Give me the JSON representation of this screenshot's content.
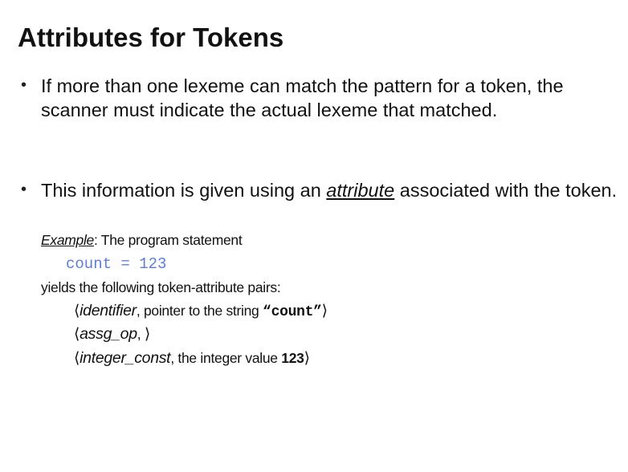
{
  "title": "Attributes for Tokens",
  "bullets": [
    {
      "text": "If more than one lexeme can match the pattern for a token, the scanner must indicate the actual lexeme that matched."
    },
    {
      "before": "This information is given using an ",
      "emphasis": "attribute",
      "after": " associated with the token."
    }
  ],
  "example": {
    "label": "Example",
    "rest": ": The program statement",
    "code": "count = 123",
    "yields": "yields the following token-attribute pairs:"
  },
  "pairs": [
    {
      "open": "⟨",
      "name": "identifier",
      "sep": ",  pointer to the string ",
      "quote_open": "“",
      "value": "count",
      "quote_close": "”",
      "close": "⟩"
    },
    {
      "open": "⟨",
      "name": "assg_op",
      "sep": ", ",
      "close": "⟩"
    },
    {
      "open": "⟨",
      "name": "integer_const",
      "sep": ",  the integer value ",
      "value": "123",
      "close": "⟩"
    }
  ]
}
